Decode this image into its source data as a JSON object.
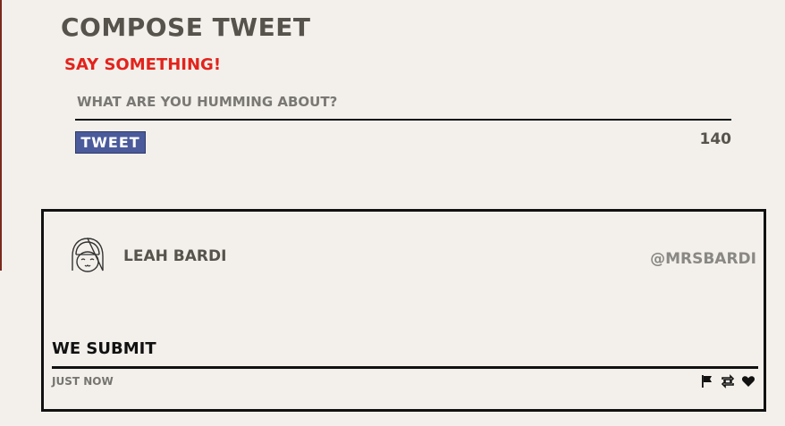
{
  "compose": {
    "title": "Compose Tweet",
    "subtitle": "Say Something!",
    "input_placeholder": "What are you humming about?",
    "submit_label": "Tweet",
    "char_count": "140"
  },
  "tweet": {
    "user_name": "Leah Bardi",
    "handle": "@mrsbardi",
    "text": "we submit",
    "timestamp": "Just now",
    "avatar_icon": "girl-avatar-icon",
    "actions": [
      "flag-icon",
      "retweet-icon",
      "heart-icon"
    ]
  },
  "colors": {
    "background": "#f3f0eb",
    "accent_red": "#e3231c",
    "button_blue": "#4a5a9b",
    "text_dark": "#55534c"
  }
}
